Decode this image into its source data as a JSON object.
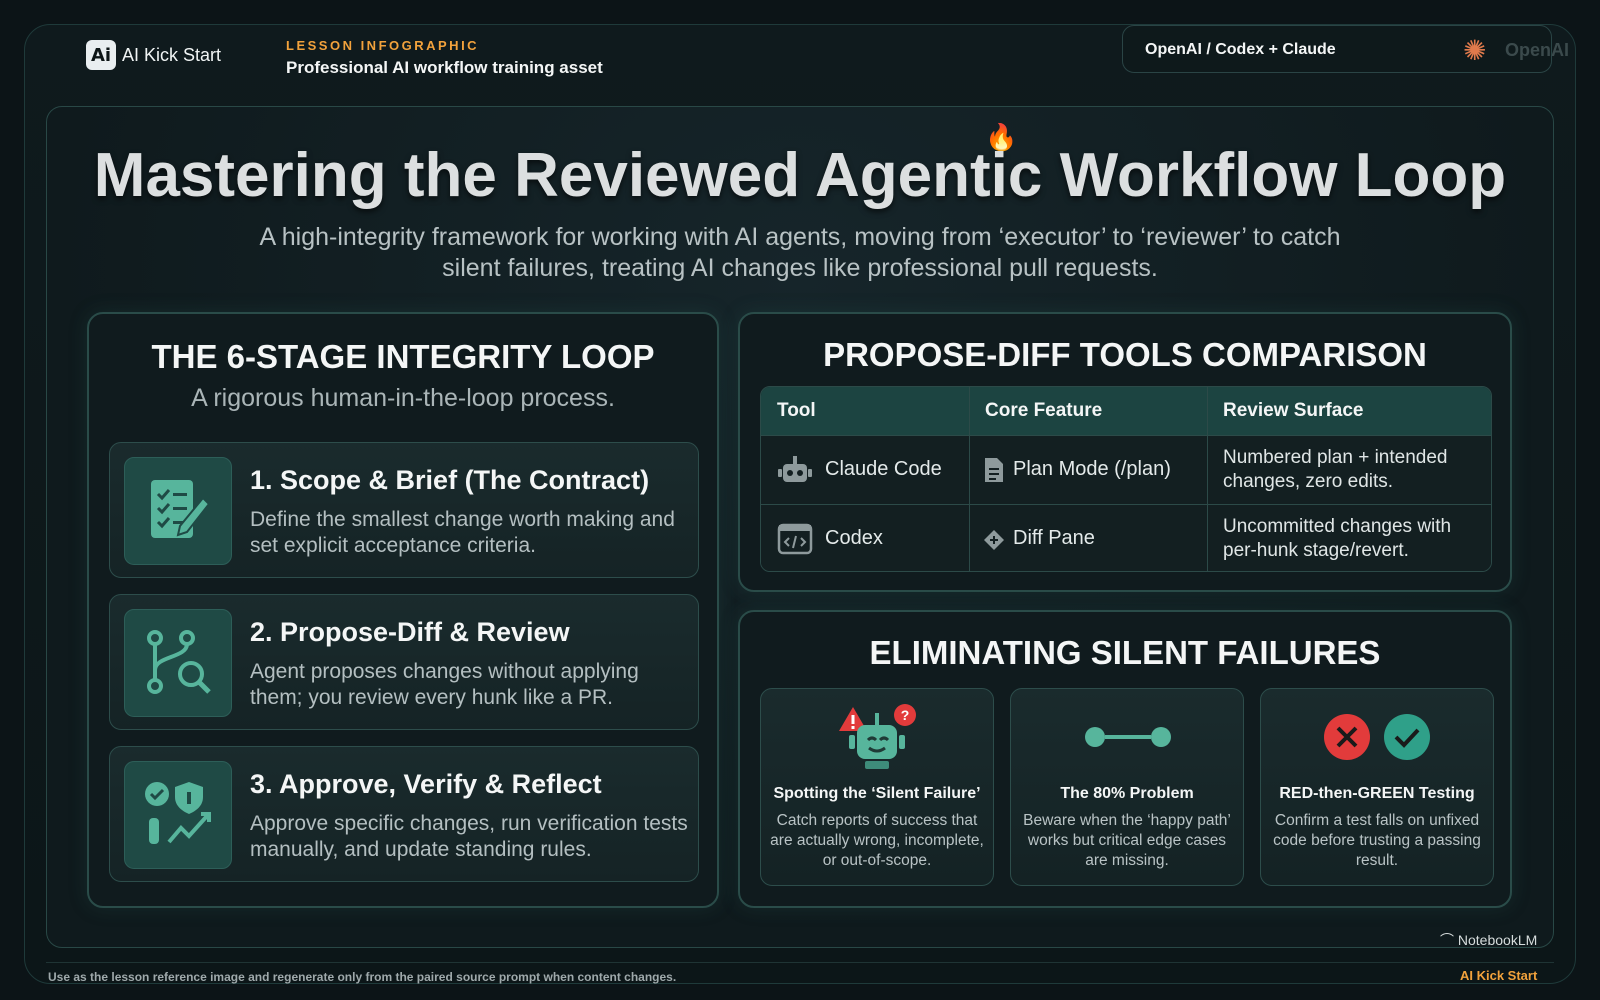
{
  "header": {
    "brand_logo_text": "Ai",
    "brand_name": "AI Kick Start",
    "kicker": "LESSON INFOGRAPHIC",
    "kicker_sub": "Professional AI workflow training asset",
    "partners": "OpenAI / Codex + Claude",
    "partner_ghost": "OpenAI"
  },
  "hero": {
    "title": "Mastering the Reviewed Agentic Workflow Loop",
    "subtitle": "A high-integrity framework for working with AI agents, moving from ‘executor’ to ‘reviewer’ to catch silent failures, treating AI changes like professional pull requests."
  },
  "loop": {
    "title": "THE 6-STAGE INTEGRITY LOOP",
    "subtitle": "A rigorous human-in-the-loop process.",
    "stages": [
      {
        "title": "1. Scope & Brief (The Contract)",
        "desc": "Define the smallest change worth making and set explicit acceptance criteria.",
        "icon": "checklist-pencil-icon"
      },
      {
        "title": "2. Propose-Diff & Review",
        "desc": "Agent proposes changes without applying them; you review every hunk like a PR.",
        "icon": "branch-search-icon"
      },
      {
        "title": "3. Approve, Verify & Reflect",
        "desc": "Approve specific changes, run verification tests manually, and update standing rules.",
        "icon": "verify-shield-icon"
      }
    ]
  },
  "tools": {
    "title": "PROPOSE-DIFF TOOLS COMPARISON",
    "headers": [
      "Tool",
      "Core Feature",
      "Review Surface"
    ],
    "rows": [
      {
        "tool": "Claude Code",
        "feature": "Plan Mode (/plan)",
        "surface": "Numbered plan + intended changes, zero edits.",
        "tool_icon": "robot-icon",
        "feature_icon": "document-icon"
      },
      {
        "tool": "Codex",
        "feature": "Diff Pane",
        "surface": "Uncommitted changes with per-hunk stage/revert.",
        "tool_icon": "code-window-icon",
        "feature_icon": "diff-diamond-icon"
      }
    ]
  },
  "silent": {
    "title": "ELIMINATING SILENT FAILURES",
    "items": [
      {
        "title": "Spotting the ‘Silent Failure’",
        "desc": "Catch reports of success that are actually wrong, incomplete, or out-of-scope.",
        "icon": "warning-robot-icon"
      },
      {
        "title": "The 80% Problem",
        "desc": "Beware when the ‘happy path’ works but critical edge cases are missing.",
        "icon": "path-nodes-icon"
      },
      {
        "title": "RED-then-GREEN Testing",
        "desc": "Confirm a test falls on unfixed code before trusting a passing result.",
        "icon": "red-green-icon"
      }
    ]
  },
  "footer": {
    "notebook": "NotebookLM",
    "note": "Use as the lesson reference image and regenerate only from the paired source prompt when content changes.",
    "brand": "AI Kick Start"
  },
  "colors": {
    "accent_orange": "#f2a23c",
    "teal": "#1f4a45",
    "red": "#e23b3b",
    "green": "#2fa089"
  }
}
